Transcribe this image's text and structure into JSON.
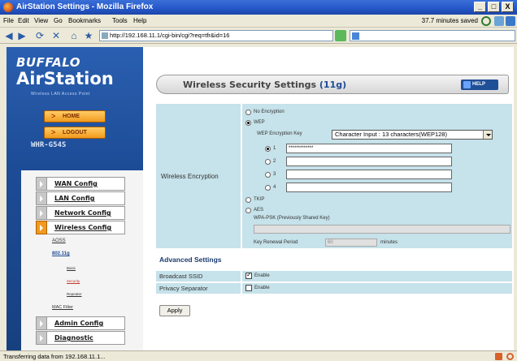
{
  "window": {
    "title": "AirStation Settings - Mozilla Firefox",
    "minimize": "_",
    "maximize": "□",
    "close": "X"
  },
  "menu": {
    "items": [
      "File",
      "Edit",
      "View",
      "Go",
      "Bookmarks",
      "Tools",
      "Help"
    ],
    "saved_status": "37.7 minutes saved"
  },
  "nav": {
    "url": "http://192.168.11.1/cgi-bin/cgi?req=tfr&id=16"
  },
  "sidebar": {
    "brand": "BUFFALO",
    "product": "AirStation",
    "subtitle": "Wireless LAN Access Point",
    "home": "HOME",
    "logout": "LOGOUT",
    "model": "WHR-G54S",
    "items": [
      {
        "label": "WAN Config"
      },
      {
        "label": "LAN Config"
      },
      {
        "label": "Network Config"
      },
      {
        "label": "Wireless Config"
      },
      {
        "label": "Admin Config"
      },
      {
        "label": "Diagnostic"
      }
    ],
    "sub": {
      "aoss": "AOSS",
      "g11": "802.11g",
      "basic": "Basic",
      "security": "Security",
      "repeater": "Repeater",
      "mac_filter": "MAC Filter"
    }
  },
  "header": {
    "title_prefix": "Wireless Security Settings ",
    "title_suffix": "(11g)",
    "help": "HELP"
  },
  "encryption": {
    "label": "Wireless Encryption",
    "no_encryption": "No Encryption",
    "wep": "WEP",
    "wep_key_label": "WEP Encryption Key",
    "wep_key_type": "Character Input : 13 characters(WEP128)",
    "keys": [
      {
        "num": "1",
        "value": "*************",
        "checked": true
      },
      {
        "num": "2",
        "value": "",
        "checked": false
      },
      {
        "num": "3",
        "value": "",
        "checked": false
      },
      {
        "num": "4",
        "value": "",
        "checked": false
      }
    ],
    "tkip": "TKIP",
    "aes": "AES",
    "wpa_psk_label": "WPA-PSK (Previously Shared Key)",
    "renewal_label": "Key Renewal Period",
    "renewal_value": "60",
    "renewal_unit": "minutes"
  },
  "advanced": {
    "title": "Advanced Settings",
    "broadcast_ssid": "Broadcast SSID",
    "privacy_separator": "Privacy Separator",
    "enable": "Enable"
  },
  "apply": "Apply",
  "status": {
    "text": "Transferring data from 192.168.11.1..."
  }
}
